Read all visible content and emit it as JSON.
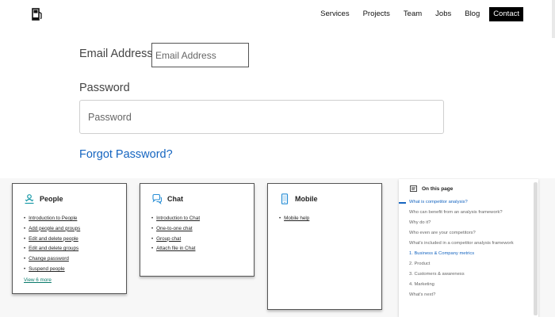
{
  "nav": {
    "items": [
      "Services",
      "Projects",
      "Team",
      "Jobs",
      "Blog"
    ],
    "contact_label": "Contact"
  },
  "login": {
    "email_label": "Email Address",
    "email_placeholder": "Email Address",
    "password_label": "Password",
    "password_placeholder": "Password",
    "forgot_label": "Forgot Password?"
  },
  "cards": {
    "people": {
      "title": "People",
      "links": [
        "Introduction to People",
        "Add people and groups",
        "Edit and delete people",
        "Edit and delete groups",
        "Change password",
        "Suspend people"
      ],
      "view_more": "View 6 more"
    },
    "chat": {
      "title": "Chat",
      "links": [
        "Introduction to Chat",
        "One-to-one chat",
        "Group chat",
        "Attach file in Chat"
      ]
    },
    "mobile": {
      "title": "Mobile",
      "links": [
        "Mobile help"
      ]
    }
  },
  "on_this_page": {
    "title": "On this page",
    "items": [
      "What is competitor analysis?",
      "Who can benefit from an analysis framework?",
      "Why do it?",
      "Who even are your competitors?",
      "What's included in a competitor analysis framework",
      "1. Business & Company metrics",
      "2. Product",
      "3. Customers & awareness",
      "4. Marketing",
      "What's next?"
    ]
  },
  "colors": {
    "link_blue": "#1565c0",
    "view_more_teal": "#0a7a6b",
    "people_icon": "#1a9aa8",
    "chat_icon": "#2a8fd6",
    "mobile_icon": "#2a8fd6"
  }
}
